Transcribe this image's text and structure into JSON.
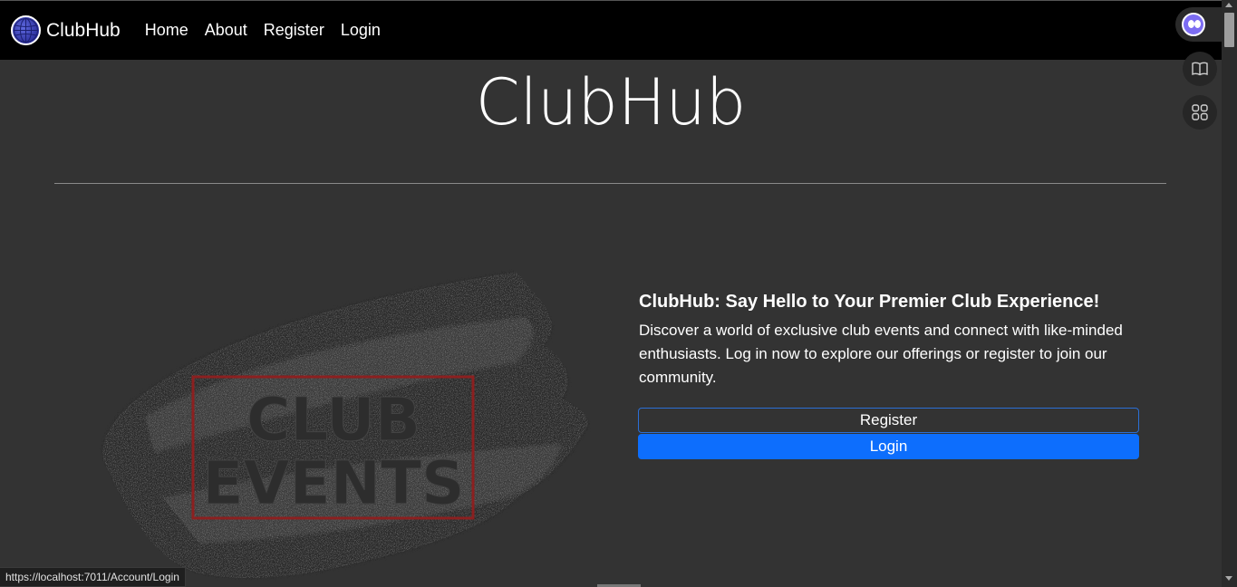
{
  "navbar": {
    "brand": "ClubHub",
    "links": [
      "Home",
      "About",
      "Register",
      "Login"
    ]
  },
  "hero": {
    "title": "ClubHub"
  },
  "image": {
    "text_line1": "CLUB",
    "text_line2": "EVENTS"
  },
  "info": {
    "heading": "ClubHub: Say Hello to Your Premier Club Experience!",
    "text": "Discover a world of exclusive club events and connect with like-minded enthusiasts. Log in now to explore our offerings or register to join our community."
  },
  "buttons": {
    "register": "Register",
    "login": "Login"
  },
  "status_bar": {
    "url": "https://localhost:7011/Account/Login"
  },
  "colors": {
    "background": "#333333",
    "navbar": "#000000",
    "primary": "#0d6efd"
  },
  "icons": [
    "globe-icon",
    "extension-face-icon",
    "book-icon",
    "apps-grid-icon"
  ]
}
